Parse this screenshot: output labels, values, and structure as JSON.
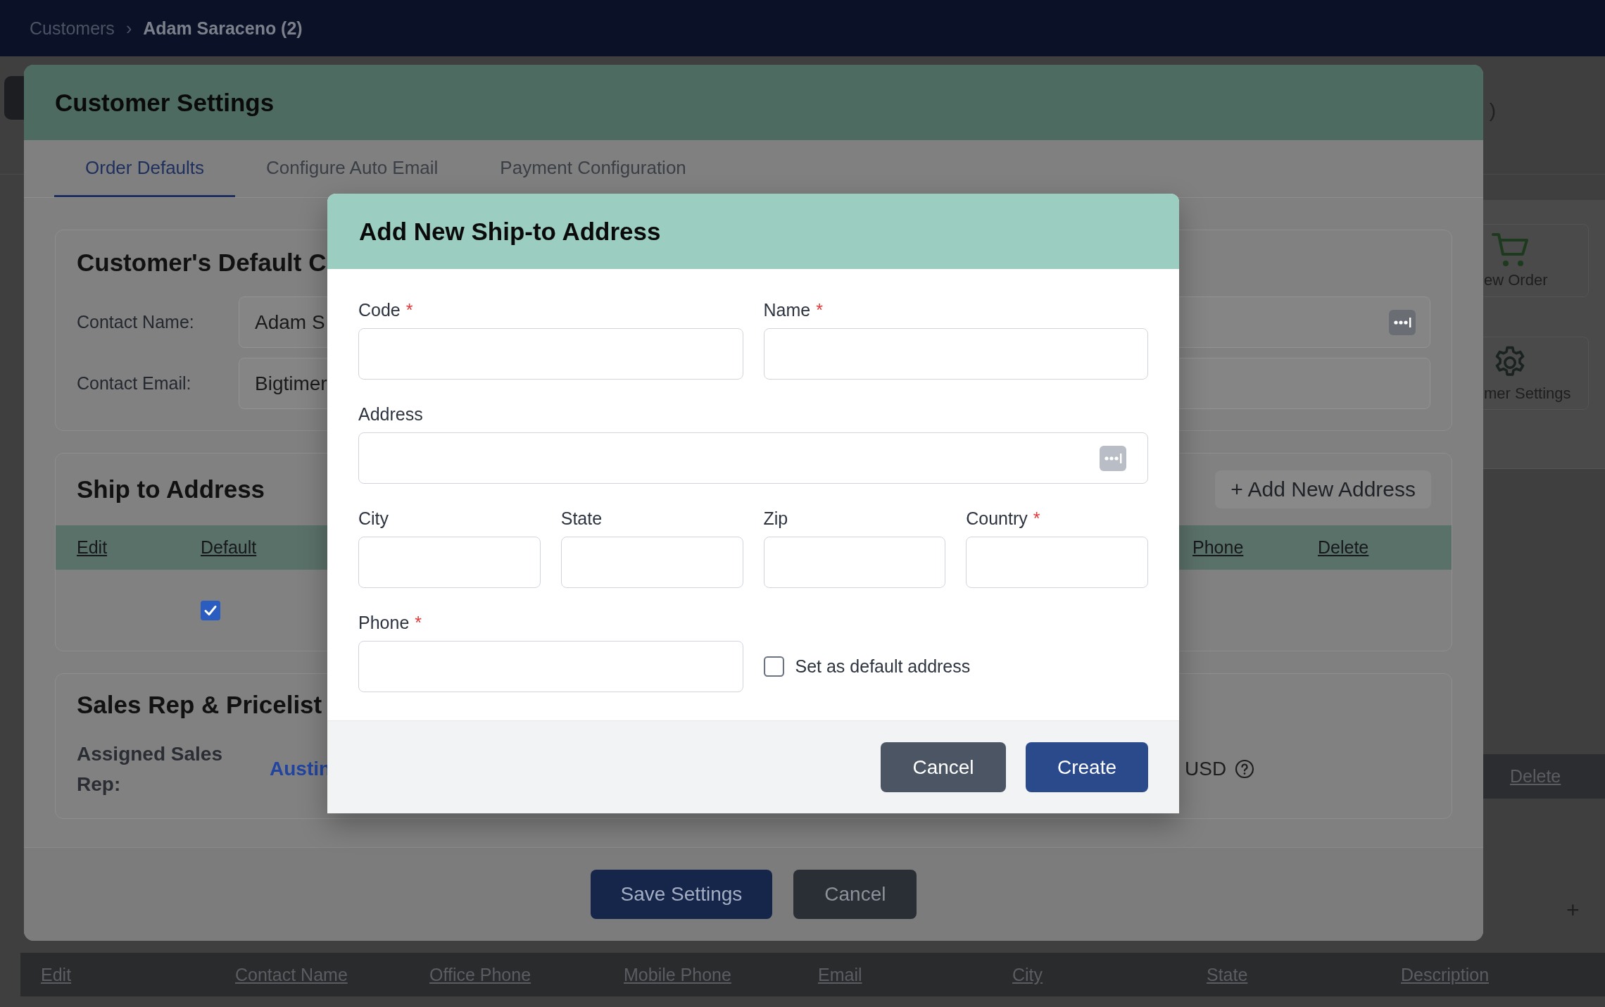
{
  "nav": {
    "breadcrumb": [
      {
        "label": "Customers"
      },
      {
        "label": "Adam Saraceno (2)"
      }
    ],
    "separator": "›"
  },
  "background": {
    "header_fragment": ")",
    "tiles": [
      {
        "kind": "cart",
        "label": "ew Order"
      },
      {
        "kind": "gear",
        "label": "mer Settings"
      }
    ],
    "row_action": "Delete",
    "add_fragment": "+",
    "table_columns": [
      "Edit",
      "Contact Name",
      "Office Phone",
      "Mobile Phone",
      "Email",
      "City",
      "State",
      "Description"
    ]
  },
  "settings_modal": {
    "title": "Customer Settings",
    "tabs": [
      {
        "label": "Order Defaults",
        "selected": true
      },
      {
        "label": "Configure Auto Email",
        "selected": false
      },
      {
        "label": "Payment Configuration",
        "selected": false
      }
    ],
    "contact": {
      "title": "Customer's Default C",
      "fields": [
        {
          "label": "Contact Name:",
          "value": "Adam S",
          "kind": "lookup"
        },
        {
          "label": "Contact Email:",
          "value": "Bigtimer",
          "kind": "text"
        }
      ]
    },
    "ship_to": {
      "title": "Ship to Address",
      "add_button": "+ Add New Address",
      "columns": [
        "Edit",
        "Default",
        "Phone",
        "Delete"
      ],
      "rows": [
        {
          "default": true
        }
      ]
    },
    "sales": {
      "title": "Sales Rep & Pricelist",
      "rep_label": "Assigned Sales Rep:",
      "rep_value": "Austin",
      "currency": "USD"
    },
    "buttons": {
      "save": "Save Settings",
      "cancel": "Cancel"
    }
  },
  "ship_to_modal": {
    "title": "Add New Ship-to Address",
    "rows": [
      {
        "fields": [
          {
            "kind": "text",
            "label": "Code",
            "required_mark": "*"
          },
          {
            "kind": "text",
            "label": "Name",
            "required_mark": "*"
          }
        ]
      },
      {
        "fields": [
          {
            "kind": "lookup",
            "label": "Address"
          }
        ]
      },
      {
        "fields": [
          {
            "kind": "text",
            "label": "City"
          },
          {
            "kind": "text",
            "label": "State"
          },
          {
            "kind": "text",
            "label": "Zip"
          },
          {
            "kind": "text",
            "label": "Country",
            "required_mark": "*"
          }
        ]
      },
      {
        "fields": [
          {
            "kind": "text",
            "label": "Phone",
            "required_mark": "*"
          },
          {
            "kind": "checkbox",
            "label": "Set as default address",
            "checked": false
          }
        ]
      }
    ],
    "buttons": {
      "cancel": "Cancel",
      "create": "Create"
    }
  }
}
